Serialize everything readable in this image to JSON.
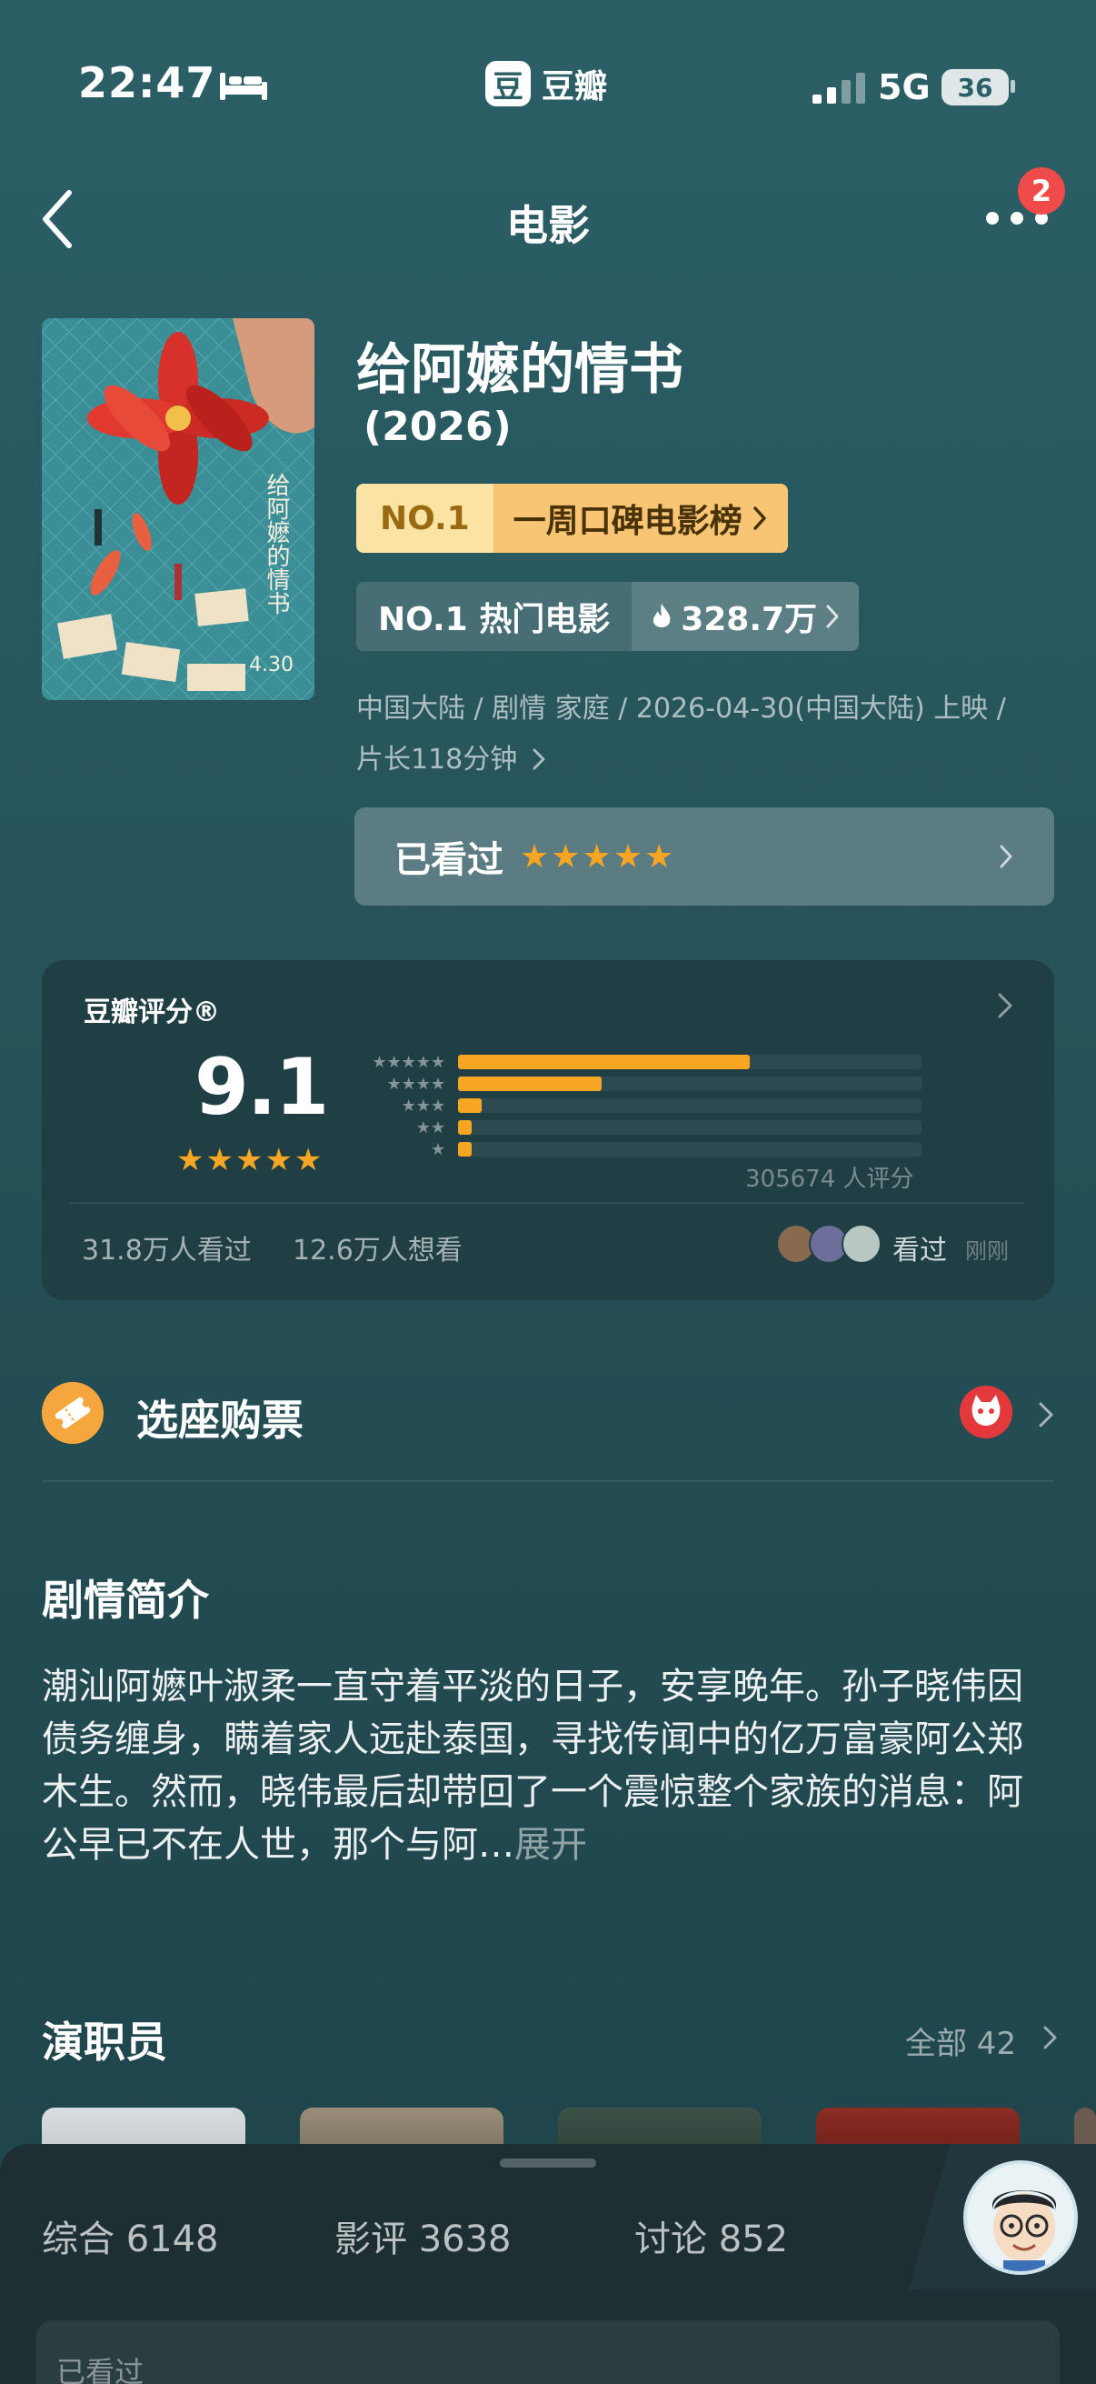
{
  "status_bar": {
    "time": "22:47",
    "app_name": "豆瓣",
    "app_logo": "豆",
    "network": "5G",
    "battery": "36"
  },
  "nav": {
    "title": "电影",
    "badge_count": "2"
  },
  "movie": {
    "title": "给阿嬷的情书",
    "year": "(2026)",
    "rank_no": "NO.1",
    "rank_label": "一周口碑电影榜",
    "hot_label": "NO.1 热门电影",
    "hot_count": "328.7万",
    "meta": "中国大陆 / 剧情 家庭 / 2026-04-30(中国大陆) 上映 / 片长118分钟",
    "watched_label": "已看过",
    "user_stars": "★★★★★"
  },
  "rating": {
    "title": "豆瓣评分®",
    "score": "9.1",
    "stars": "★★★★★",
    "distribution": [
      0.63,
      0.31,
      0.05,
      0.03,
      0.03
    ],
    "count_text": "305674 人评分",
    "watched_text": "31.8万人看过",
    "wish_text": "12.6万人想看",
    "seen_label": "看过",
    "seen_time": "刚刚"
  },
  "ticket": {
    "label": "选座购票"
  },
  "synopsis": {
    "title": "剧情简介",
    "text": "潮汕阿嬷叶淑柔一直守着平淡的日子，安享晚年。孙子晓伟因债务缠身，瞒着家人远赴泰国，寻找传闻中的亿万富豪阿公郑木生。然而，晓伟最后却带回了一个震惊整个家族的消息：阿公早已不在人世，那个与阿…",
    "more": "展开"
  },
  "cast": {
    "title": "演职员",
    "all_label": "全部 42"
  },
  "bottom_tabs": [
    {
      "label": "综合 6148"
    },
    {
      "label": "影评 3638"
    },
    {
      "label": "讨论 852"
    }
  ],
  "sub_card_label": "已看过",
  "colors": {
    "accent": "#f6a623",
    "badge": "#f04a4a",
    "bg": "#2b5f66"
  }
}
